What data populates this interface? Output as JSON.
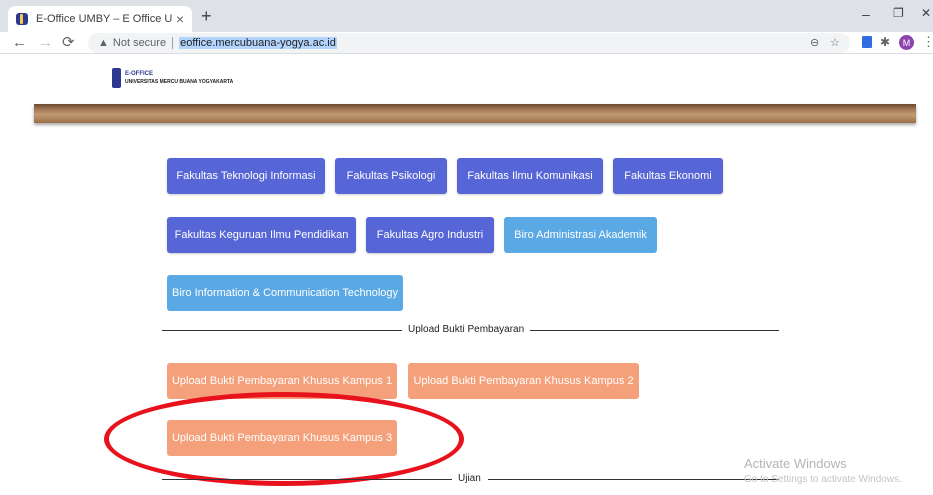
{
  "browser": {
    "tab_title": "E-Office UMBY – E Office Univers",
    "tab_close": "×",
    "new_tab": "+",
    "window_controls": {
      "minimize": "–",
      "restore": "❐",
      "close": "✕"
    },
    "nav": {
      "back": "←",
      "forward": "→",
      "reload": "⟳"
    },
    "security_label": "Not secure",
    "url": "eoffice.mercubuana-yogya.ac.id",
    "avatar_letter": "M",
    "kebab": "⋮"
  },
  "site": {
    "logo_top": "E-OFFICE",
    "logo_bottom": "UNIVERSITAS MERCU BUANA YOGYAKARTA"
  },
  "faculty_buttons": [
    "Fakultas Teknologi Informasi",
    "Fakultas Psikologi",
    "Fakultas Ilmu Komunikasi",
    "Fakultas Ekonomi",
    "Fakultas Keguruan Ilmu Pendidikan",
    "Fakultas Agro Industri",
    "Biro Administrasi Akademik",
    "Biro Information & Communication Technology"
  ],
  "section_upload": {
    "title": "Upload Bukti Pembayaran",
    "buttons": [
      "Upload Bukti Pembayaran Khusus Kampus 1",
      "Upload Bukti Pembayaran Khusus Kampus 2",
      "Upload Bukti Pembayaran Khusus Kampus 3"
    ]
  },
  "section_ujian": {
    "title": "Ujian"
  },
  "watermark": {
    "title": "Activate Windows",
    "subtitle": "Go to Settings to activate Windows."
  },
  "colors": {
    "primary_blue": "#5766d6",
    "sky_blue": "#5aa8e4",
    "orange": "#f4a07a",
    "highlight_circle": "#e8121c"
  }
}
